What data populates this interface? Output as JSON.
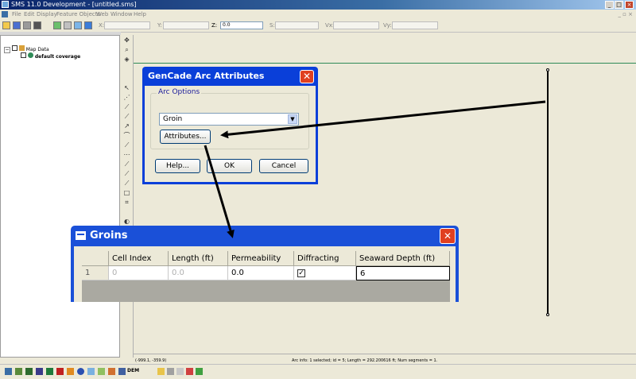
{
  "window": {
    "title": "SMS 11.0 Development - [untitled.sms]",
    "controls": {
      "minimize": "_",
      "maximize": "□",
      "close": "×"
    }
  },
  "menu": [
    "File",
    "Edit",
    "Display",
    "Feature Objects",
    "Web",
    "Window",
    "Help"
  ],
  "mdi_controls": "_ ▫ ×",
  "coords": {
    "x_label": "X:",
    "y_label": "Y:",
    "z_label": "Z:",
    "z_value": "0.0",
    "s_label": "S:",
    "vx_label": "Vx:",
    "vy_label": "Vy:"
  },
  "tree": {
    "root": "Map Data",
    "child": "default coverage"
  },
  "status": {
    "coords": "(-999.1, -359.9)",
    "info": "Arc info: 1 selected; id = 5; Length = 292.200616 ft; Num segments = 1."
  },
  "bottom_toolbar": {
    "dem_label": "DEM"
  },
  "arc_dialog": {
    "title": "GenCade Arc Attributes",
    "group_label": "Arc Options",
    "arc_type": "Groin",
    "attributes_button": "Attributes...",
    "help_button": "Help...",
    "ok_button": "OK",
    "cancel_button": "Cancel",
    "close": "✕"
  },
  "groins_dialog": {
    "title": "Groins",
    "close": "✕",
    "columns": [
      "",
      "Cell Index",
      "Length (ft)",
      "Permeability",
      "Diffracting",
      "Seaward Depth (ft)"
    ],
    "rows": [
      {
        "row": "1",
        "cell_index": "0",
        "length": "0.0",
        "permeability": "0.0",
        "diffracting": "✓",
        "seaward_depth": "6"
      }
    ]
  },
  "colors": {
    "xp_blue": "#0a3fd9",
    "close_red": "#e04020",
    "canvas": "#ece9d8",
    "green_line": "#2e8b57"
  }
}
